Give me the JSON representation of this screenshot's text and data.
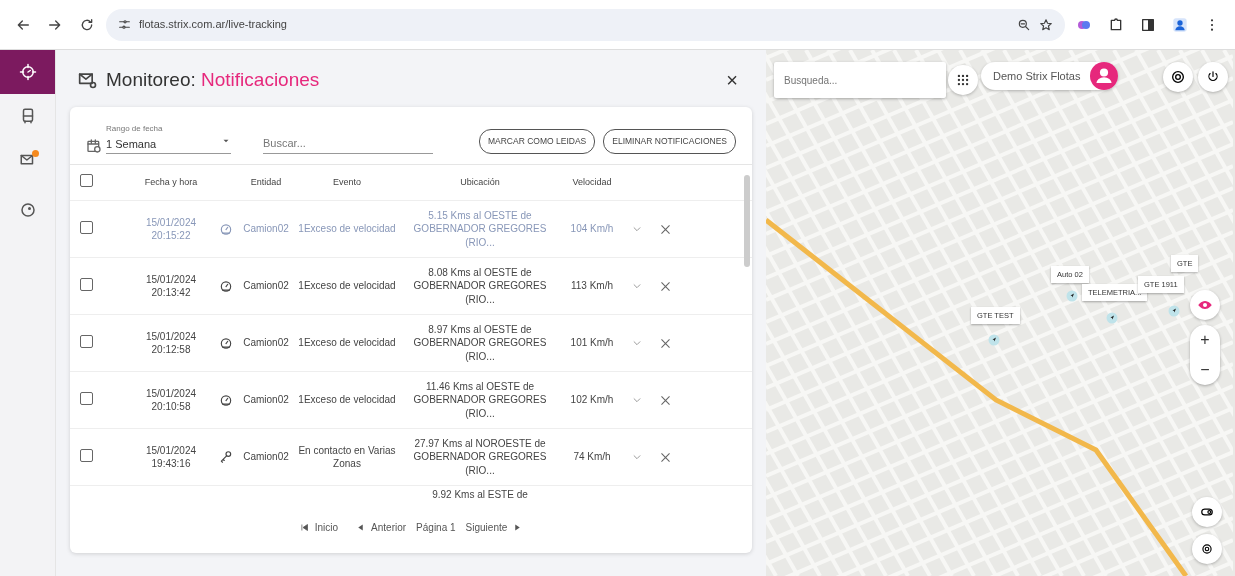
{
  "browser": {
    "url": "flotas.strix.com.ar/live-tracking"
  },
  "sidebar": {
    "items": [
      {
        "selected": true,
        "badge": false
      },
      {
        "selected": false,
        "badge": false
      },
      {
        "selected": false,
        "badge": true
      },
      {
        "selected": false,
        "badge": false
      }
    ]
  },
  "panel": {
    "title": "Monitoreo:",
    "subtitle": "Notificaciones",
    "close": "×"
  },
  "filters": {
    "range_label": "Rango de fecha",
    "range_value": "1 Semana",
    "search_placeholder": "Buscar...",
    "buttons": [
      "MARCAR COMO LEIDAS",
      "ELIMINAR NOTIFICACIONES"
    ]
  },
  "table": {
    "select_all": false,
    "columns": [
      "Fecha y hora",
      "Entidad",
      "Evento",
      "Ubicación",
      "Velocidad"
    ],
    "rows": [
      {
        "checked": false,
        "read": true,
        "date": "15/01/2024",
        "time": "20:15:22",
        "kind": "speed",
        "entity": "Camion02",
        "event": "1Exceso de velocidad",
        "location": "5.15 Kms al OESTE de GOBERNADOR GREGORES (RIO...",
        "speed": "104 Km/h"
      },
      {
        "checked": false,
        "read": false,
        "date": "15/01/2024",
        "time": "20:13:42",
        "kind": "speed",
        "entity": "Camion02",
        "event": "1Exceso de velocidad",
        "location": "8.08 Kms al OESTE de GOBERNADOR GREGORES (RIO...",
        "speed": "113 Km/h"
      },
      {
        "checked": false,
        "read": false,
        "date": "15/01/2024",
        "time": "20:12:58",
        "kind": "speed",
        "entity": "Camion02",
        "event": "1Exceso de velocidad",
        "location": "8.97 Kms al OESTE de GOBERNADOR GREGORES (RIO...",
        "speed": "101 Km/h"
      },
      {
        "checked": false,
        "read": false,
        "date": "15/01/2024",
        "time": "20:10:58",
        "kind": "speed",
        "entity": "Camion02",
        "event": "1Exceso de velocidad",
        "location": "11.46 Kms al OESTE de GOBERNADOR GREGORES (RIO...",
        "speed": "102 Km/h"
      },
      {
        "checked": false,
        "read": false,
        "date": "15/01/2024",
        "time": "19:43:16",
        "kind": "contact",
        "entity": "Camion02",
        "event": "En contacto en Varias Zonas",
        "location": "27.97 Kms al NOROESTE de GOBERNADOR GREGORES (RIO...",
        "speed": "74 Km/h"
      }
    ],
    "partial_row": {
      "location": "9.92 Kms al ESTE de"
    }
  },
  "pagination": {
    "first": "Inicio",
    "prev": "Anterior",
    "page": "Página 1",
    "next": "Siguiente"
  },
  "map": {
    "search_placeholder": "Busqueda...",
    "user": "Demo Strix Flotas",
    "markers": [
      {
        "label": "GTE TEST"
      },
      {
        "label": "Auto 02"
      },
      {
        "label": "TELEMETRIA..."
      },
      {
        "label": "GTE 1911"
      },
      {
        "label": "GTE"
      }
    ],
    "zoom": [
      "+",
      "−"
    ]
  }
}
